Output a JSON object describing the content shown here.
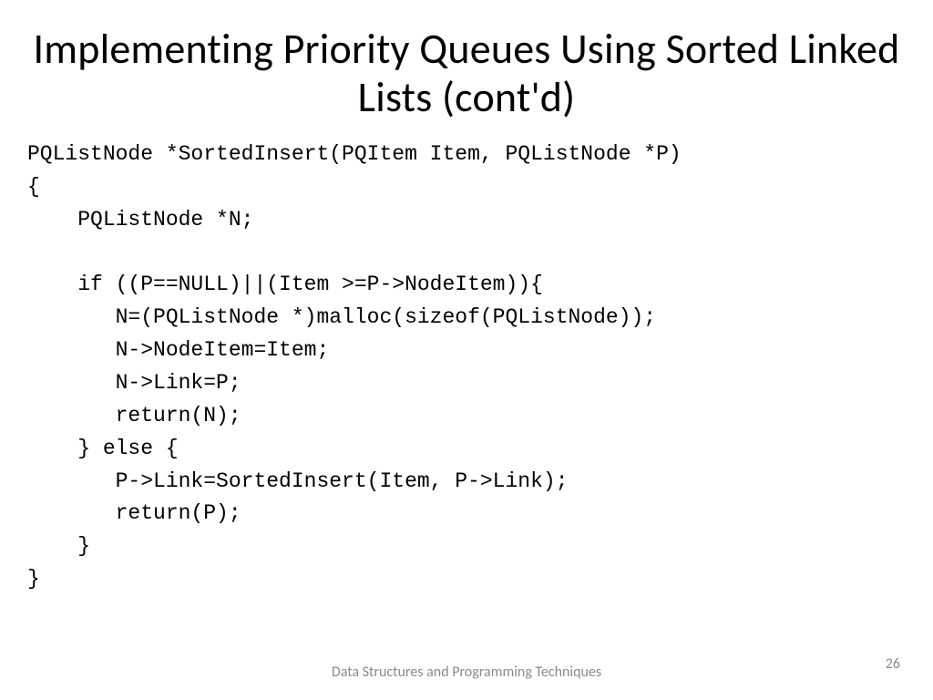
{
  "slide": {
    "title": "Implementing Priority Queues Using Sorted Linked Lists (cont'd)",
    "code": "PQListNode *SortedInsert(PQItem Item, PQListNode *P)\n{\n    PQListNode *N;\n\n    if ((P==NULL)||(Item >=P->NodeItem)){\n       N=(PQListNode *)malloc(sizeof(PQListNode));\n       N->NodeItem=Item;\n       N->Link=P;\n       return(N);\n    } else {\n       P->Link=SortedInsert(Item, P->Link);\n       return(P);\n    }\n}",
    "footer": "Data Structures and Programming\nTechniques",
    "page_number": "26"
  }
}
